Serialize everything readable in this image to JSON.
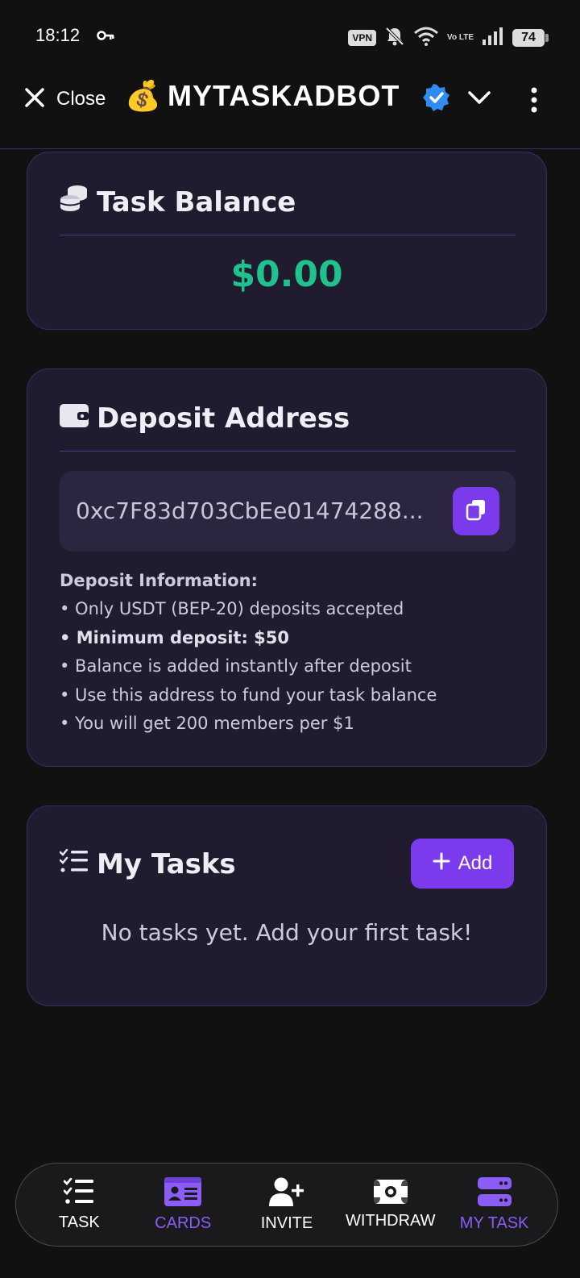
{
  "status_bar": {
    "time": "18:12",
    "vpn": "VPN",
    "network": "Vo LTE",
    "battery": "74"
  },
  "header": {
    "close_label": "Close",
    "bot_emoji": "💰",
    "title": "MYTASKADBOT"
  },
  "balance": {
    "title": "Task Balance",
    "amount": "$0.00",
    "amount_color": "#1fc28c"
  },
  "deposit": {
    "title": "Deposit Address",
    "address": "0xc7F83d703CbEe01474288...",
    "info_title": "Deposit Information:",
    "info_items": [
      "• Only USDT (BEP-20) deposits accepted",
      "• Minimum deposit: $50",
      "• Balance is added instantly after deposit",
      "• Use this address to fund your task balance",
      "• You will get 200 members per $1"
    ]
  },
  "tasks": {
    "title": "My Tasks",
    "add_label": "Add",
    "empty_text": "No tasks yet. Add your first task!"
  },
  "nav": {
    "items": [
      {
        "label": "TASK",
        "icon": "checklist-icon"
      },
      {
        "label": "CARDS",
        "icon": "id-card-icon"
      },
      {
        "label": "INVITE",
        "icon": "user-plus-icon"
      },
      {
        "label": "WITHDRAW",
        "icon": "money-bill-icon"
      },
      {
        "label": "MY TASK",
        "icon": "server-icon"
      }
    ],
    "active_color": "#8b5cf6"
  },
  "accent": "#7c3aed"
}
